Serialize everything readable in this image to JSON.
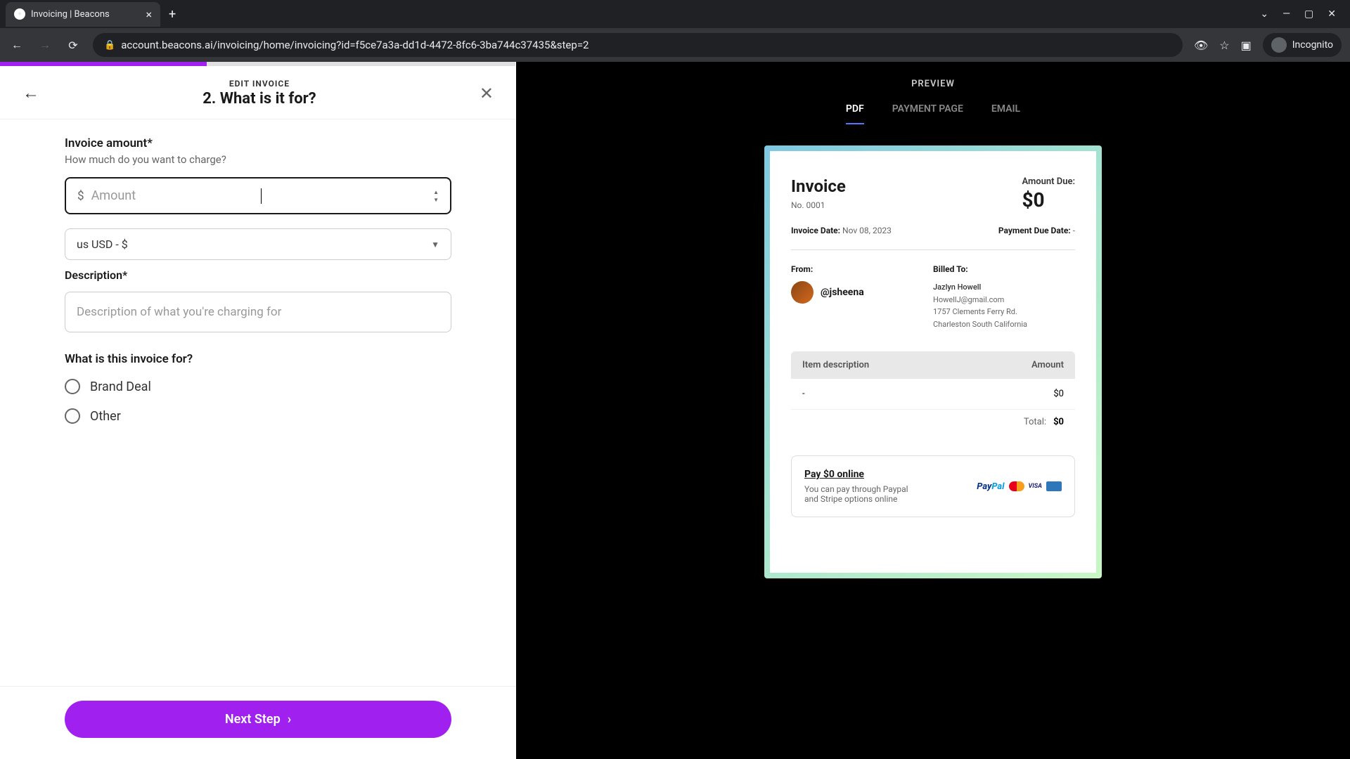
{
  "browser": {
    "tab_title": "Invoicing | Beacons",
    "url": "account.beacons.ai/invoicing/home/invoicing?id=f5ce7a3a-dd1d-4472-8fc6-3ba744c37435&step=2",
    "incognito_label": "Incognito"
  },
  "header": {
    "label": "EDIT INVOICE",
    "title": "2. What is it for?"
  },
  "form": {
    "amount_label": "Invoice amount*",
    "amount_hint": "How much do you want to charge?",
    "amount_placeholder": "Amount",
    "currency_prefix": "$",
    "currency_selected": "us USD - $",
    "desc_label": "Description*",
    "desc_placeholder": "Description of what you're charging for",
    "purpose_label": "What is this invoice for?",
    "radio_brand": "Brand Deal",
    "radio_other": "Other",
    "next_button": "Next Step"
  },
  "preview": {
    "label": "PREVIEW",
    "tabs": {
      "pdf": "PDF",
      "payment": "PAYMENT PAGE",
      "email": "EMAIL"
    },
    "invoice": {
      "title": "Invoice",
      "number": "No. 0001",
      "amount_due_label": "Amount Due:",
      "amount_due": "$0",
      "invoice_date_label": "Invoice Date:",
      "invoice_date": "Nov 08, 2023",
      "payment_due_label": "Payment Due Date:",
      "payment_due": "-",
      "from_label": "From:",
      "from_name": "@jsheena",
      "billed_label": "Billed To:",
      "billed_name": "Jazlyn Howell",
      "billed_email": "HowellJ@gmail.com",
      "billed_addr1": "1757 Clements Ferry Rd.",
      "billed_addr2": "Charleston South California",
      "col_desc": "Item description",
      "col_amount": "Amount",
      "item_desc": "-",
      "item_amount": "$0",
      "total_label": "Total:",
      "total_val": "$0",
      "pay_link": "Pay $0 online",
      "pay_text": "You can pay through Paypal and Stripe options online"
    }
  }
}
